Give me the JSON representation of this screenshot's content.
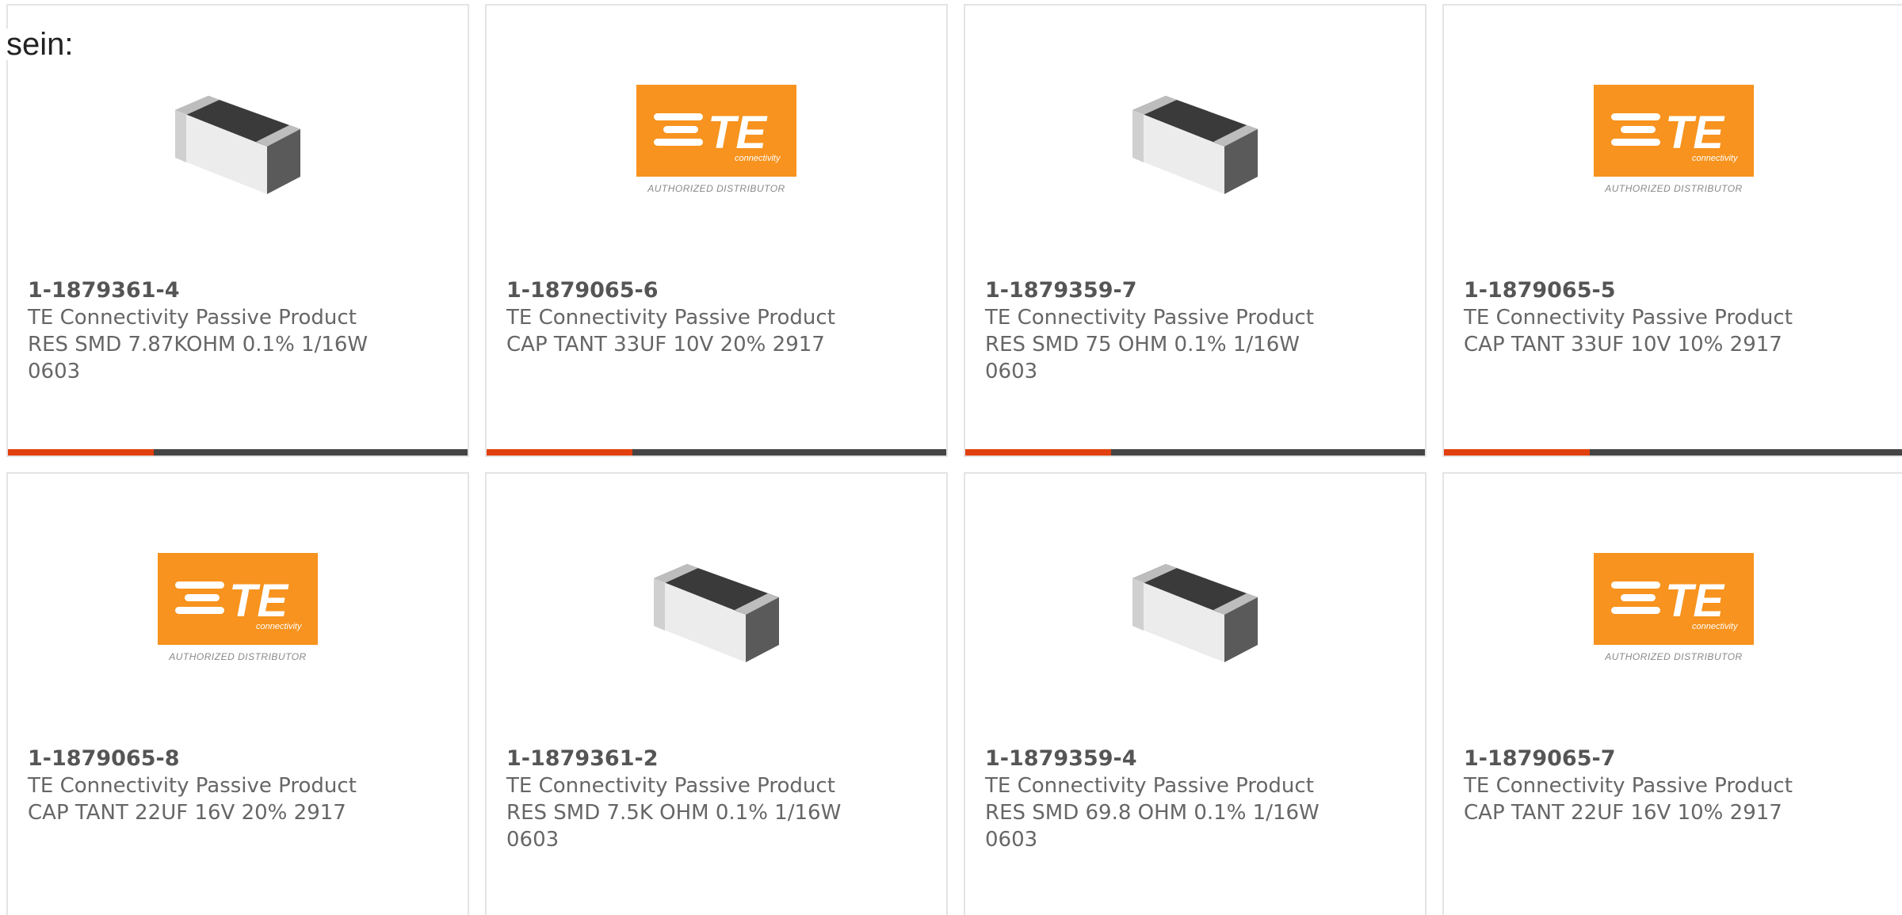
{
  "heading": "sein:",
  "colors": {
    "accent": "#e2400e",
    "bar": "#444444",
    "logo_orange": "#f7931e"
  },
  "logo": {
    "name": "TE",
    "sub": "connectivity",
    "authorized": "AUTHORIZED DISTRIBUTOR"
  },
  "products": [
    {
      "part": "1-1879361-4",
      "maker": "TE Connectivity Passive Product",
      "desc": "RES SMD 7.87KOHM 0.1% 1/16W 0603",
      "image": "resistor-chip-icon"
    },
    {
      "part": "1-1879065-6",
      "maker": "TE Connectivity Passive Product",
      "desc": "CAP TANT 33UF 10V 20% 2917",
      "image": "te-logo"
    },
    {
      "part": "1-1879359-7",
      "maker": "TE Connectivity Passive Product",
      "desc": "RES SMD 75 OHM 0.1% 1/16W 0603",
      "image": "resistor-chip-icon"
    },
    {
      "part": "1-1879065-5",
      "maker": "TE Connectivity Passive Product",
      "desc": "CAP TANT 33UF 10V 10% 2917",
      "image": "te-logo"
    },
    {
      "part": "1-1879065-8",
      "maker": "TE Connectivity Passive Product",
      "desc": "CAP TANT 22UF 16V 20% 2917",
      "image": "te-logo"
    },
    {
      "part": "1-1879361-2",
      "maker": "TE Connectivity Passive Product",
      "desc": "RES SMD 7.5K OHM 0.1% 1/16W 0603",
      "image": "resistor-chip-icon"
    },
    {
      "part": "1-1879359-4",
      "maker": "TE Connectivity Passive Product",
      "desc": "RES SMD 69.8 OHM 0.1% 1/16W 0603",
      "image": "resistor-chip-icon"
    },
    {
      "part": "1-1879065-7",
      "maker": "TE Connectivity Passive Product",
      "desc": "CAP TANT 22UF 16V 10% 2917",
      "image": "te-logo"
    }
  ]
}
